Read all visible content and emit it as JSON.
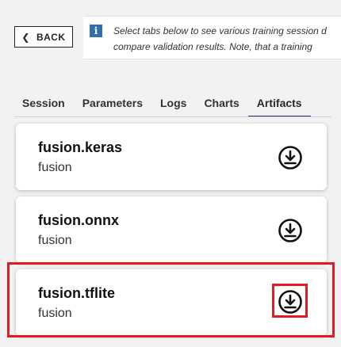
{
  "back_button": {
    "label": "BACK",
    "icon": "chevron-left-icon"
  },
  "info": {
    "icon": "info-icon",
    "icon_glyph": "i",
    "line1": "Select tabs below to see various training session d",
    "line2": "compare validation results. Note, that a training"
  },
  "tabs": [
    {
      "label": "Session",
      "active": false
    },
    {
      "label": "Parameters",
      "active": false
    },
    {
      "label": "Logs",
      "active": false
    },
    {
      "label": "Charts",
      "active": false
    },
    {
      "label": "Artifacts",
      "active": true
    }
  ],
  "artifacts": [
    {
      "name": "fusion.keras",
      "subtitle": "fusion",
      "icon": "download-icon"
    },
    {
      "name": "fusion.onnx",
      "subtitle": "fusion",
      "icon": "download-icon"
    },
    {
      "name": "fusion.tflite",
      "subtitle": "fusion",
      "icon": "download-icon"
    }
  ],
  "colors": {
    "highlight": "#e01b24",
    "active_tab_underline": "#3a2f7a",
    "info_icon_bg": "#2f6fb0"
  }
}
